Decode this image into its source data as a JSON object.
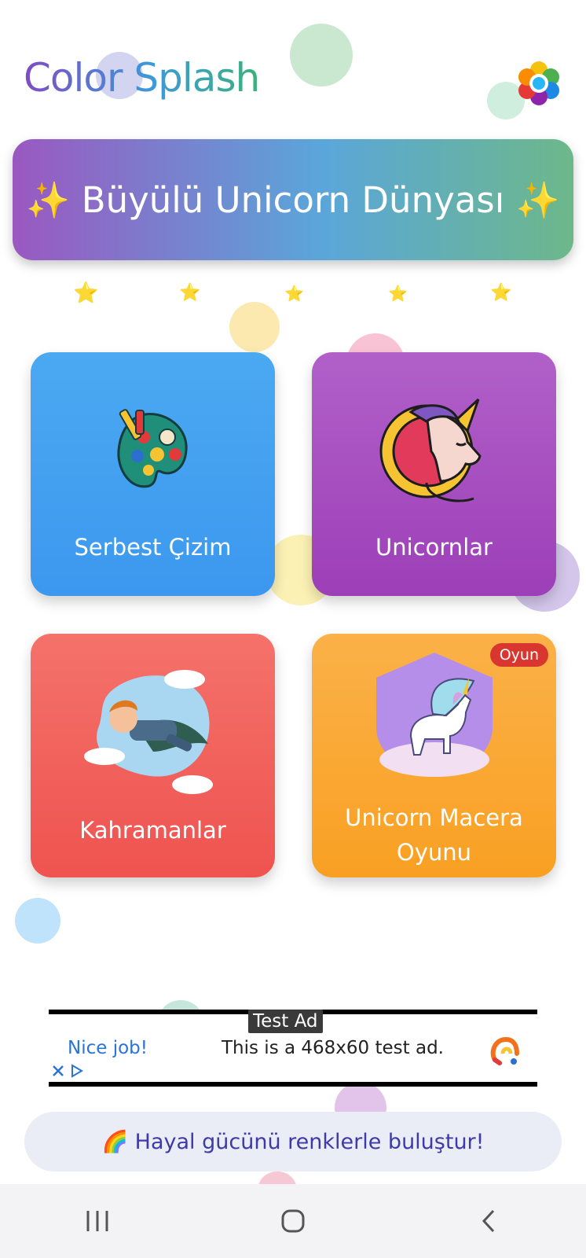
{
  "app": {
    "title": "Color Splash"
  },
  "hero": {
    "title": "✨ Büyülü Unicorn Dünyası ✨"
  },
  "stars": [
    "⭐",
    "⭐",
    "⭐",
    "⭐",
    "⭐"
  ],
  "cards": [
    {
      "label": "Serbest Çizim",
      "icon": "palette-icon",
      "color_from": "#4ba9f2",
      "color_to": "#3c98ee"
    },
    {
      "label": "Unicornlar",
      "icon": "unicorn-head-icon",
      "color_from": "#b160c9",
      "color_to": "#9d3fb8"
    },
    {
      "label": "Kahramanlar",
      "icon": "superhero-icon",
      "color_from": "#f4726a",
      "color_to": "#ef5350"
    },
    {
      "label": "Unicorn Macera Oyunu",
      "icon": "pegasus-icon",
      "badge": "Oyun",
      "color_from": "#fbb148",
      "color_to": "#f9a023"
    }
  ],
  "ad": {
    "badge": "Test Ad",
    "left_text": "Nice job!",
    "text": "This is a 468x60 test ad."
  },
  "tagline": "🌈 Hayal gücünü renklerle buluştur!",
  "navbar": {
    "recent_icon": "recent-apps-icon",
    "home_icon": "home-icon",
    "back_icon": "back-icon"
  }
}
